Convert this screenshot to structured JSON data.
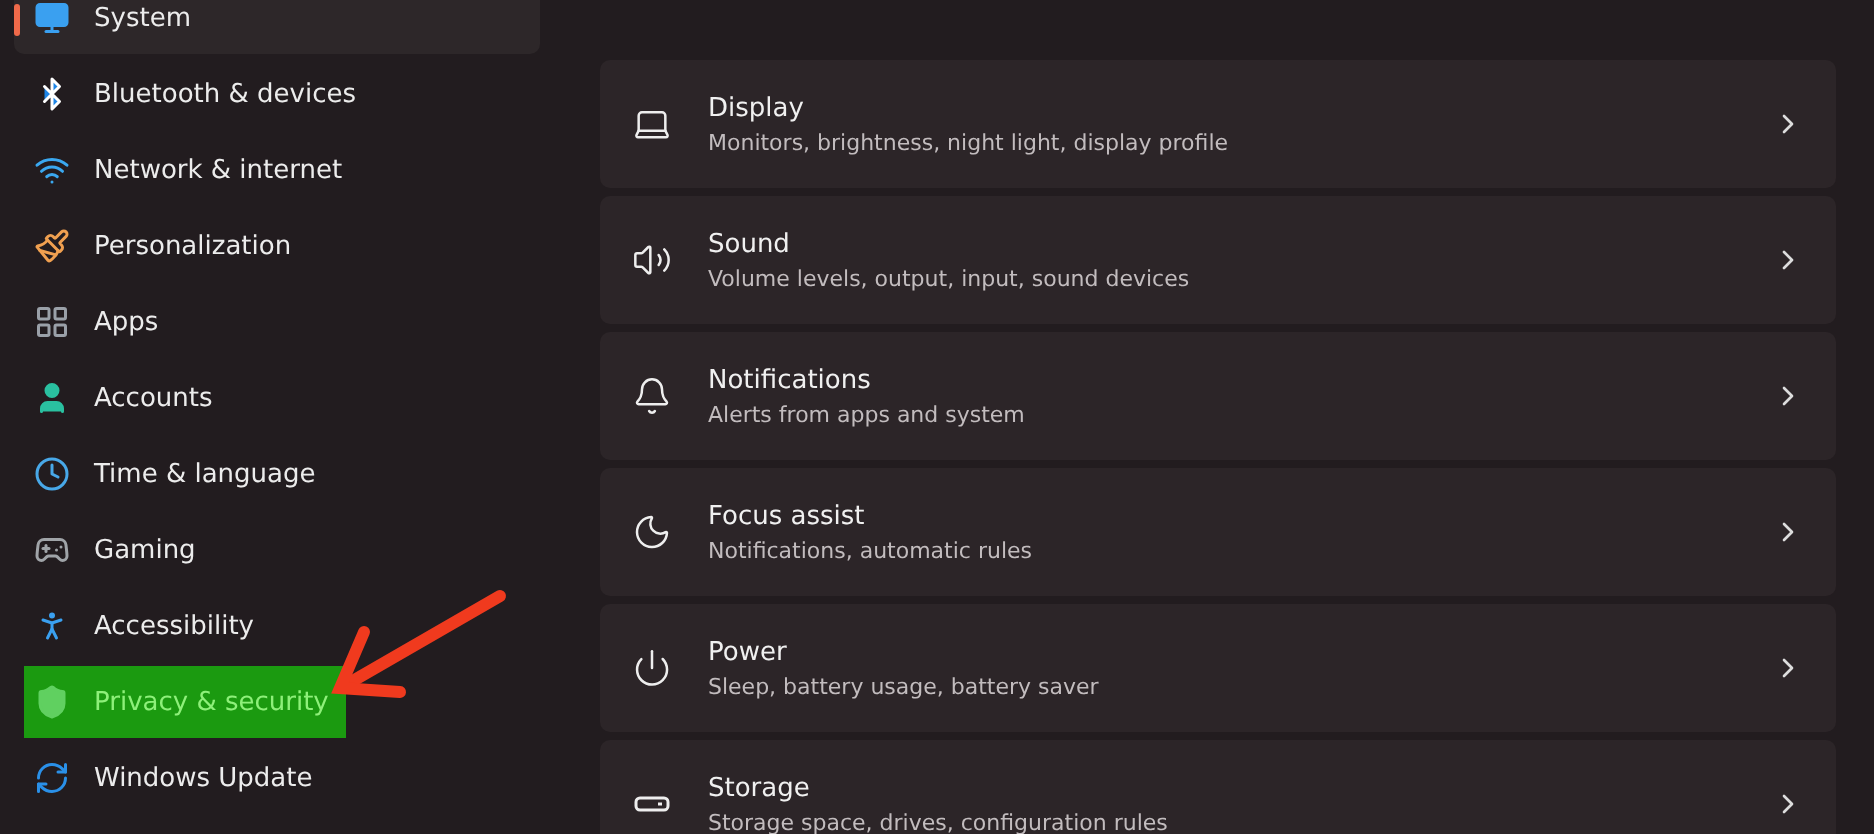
{
  "sidebar": {
    "items": [
      {
        "label": "System",
        "selected": true,
        "highlighted": false
      },
      {
        "label": "Bluetooth & devices",
        "selected": false,
        "highlighted": false
      },
      {
        "label": "Network & internet",
        "selected": false,
        "highlighted": false
      },
      {
        "label": "Personalization",
        "selected": false,
        "highlighted": false
      },
      {
        "label": "Apps",
        "selected": false,
        "highlighted": false
      },
      {
        "label": "Accounts",
        "selected": false,
        "highlighted": false
      },
      {
        "label": "Time & language",
        "selected": false,
        "highlighted": false
      },
      {
        "label": "Gaming",
        "selected": false,
        "highlighted": false
      },
      {
        "label": "Accessibility",
        "selected": false,
        "highlighted": false
      },
      {
        "label": "Privacy & security",
        "selected": false,
        "highlighted": true
      },
      {
        "label": "Windows Update",
        "selected": false,
        "highlighted": false
      }
    ]
  },
  "settings": [
    {
      "title": "Display",
      "description": "Monitors, brightness, night light, display profile"
    },
    {
      "title": "Sound",
      "description": "Volume levels, output, input, sound devices"
    },
    {
      "title": "Notifications",
      "description": "Alerts from apps and system"
    },
    {
      "title": "Focus assist",
      "description": "Notifications, automatic rules"
    },
    {
      "title": "Power",
      "description": "Sleep, battery usage, battery saver"
    },
    {
      "title": "Storage",
      "description": "Storage space, drives, configuration rules"
    }
  ]
}
